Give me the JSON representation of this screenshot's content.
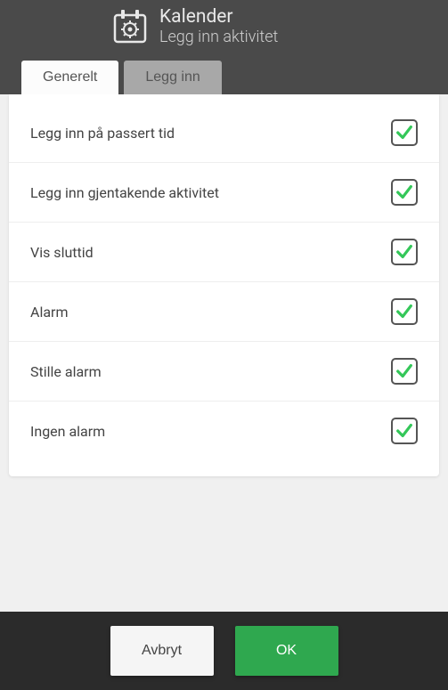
{
  "header": {
    "title": "Kalender",
    "subtitle": "Legg inn aktivitet"
  },
  "tabs": [
    {
      "label": "Generelt",
      "active": true
    },
    {
      "label": "Legg inn",
      "active": false
    }
  ],
  "settings": [
    {
      "label": "Legg inn på passert tid",
      "checked": true
    },
    {
      "label": "Legg inn gjentakende aktivitet",
      "checked": true
    },
    {
      "label": "Vis sluttid",
      "checked": true
    },
    {
      "label": "Alarm",
      "checked": true
    },
    {
      "label": "Stille alarm",
      "checked": true
    },
    {
      "label": "Ingen alarm",
      "checked": true
    }
  ],
  "footer": {
    "cancel": "Avbryt",
    "ok": "OK"
  },
  "colors": {
    "accent": "#2fa84f",
    "check": "#34c759"
  }
}
